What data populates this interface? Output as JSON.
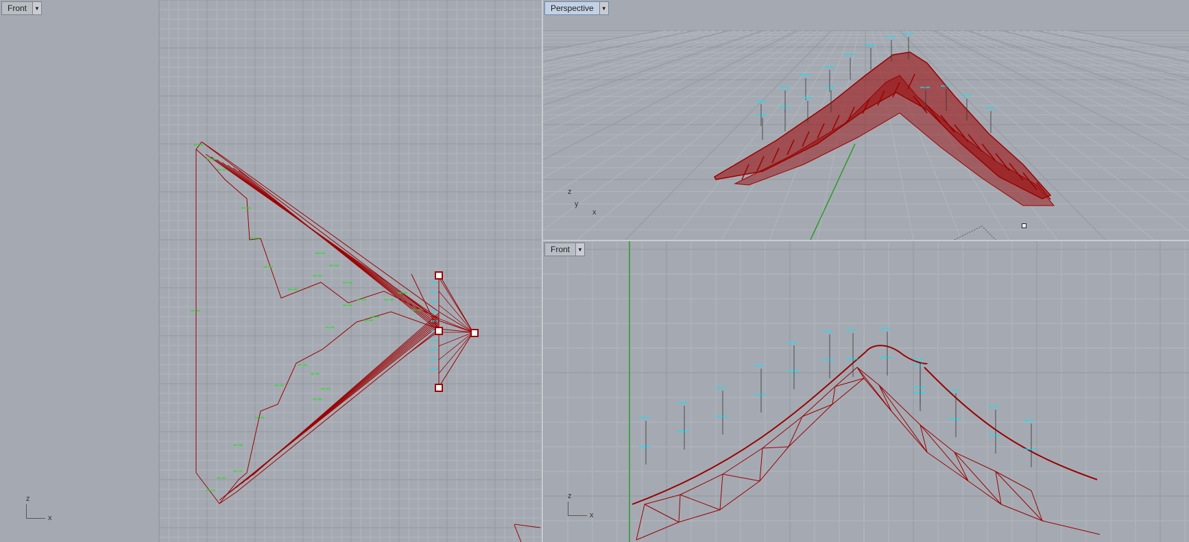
{
  "viewports": {
    "left": {
      "title": "Front",
      "axis_z": "z",
      "axis_x": "x"
    },
    "top_right": {
      "title": "Perspective",
      "axis_z": "z",
      "axis_y": "y",
      "axis_x": "x"
    },
    "bottom_right": {
      "title": "Front",
      "axis_z": "z",
      "axis_x": "x"
    }
  },
  "colors": {
    "viewport_bg": "#a5aab2",
    "grid_minor": "#b2b6bd",
    "grid_major": "#94989f",
    "model": "#9a0000",
    "label_green": "#22e022",
    "label_cyan": "#00e8ff",
    "axis_green": "#2a9a2a"
  },
  "icons": [
    "dropdown-arrow-icon",
    "axis-widget-icon",
    "grip-point-icon"
  ]
}
